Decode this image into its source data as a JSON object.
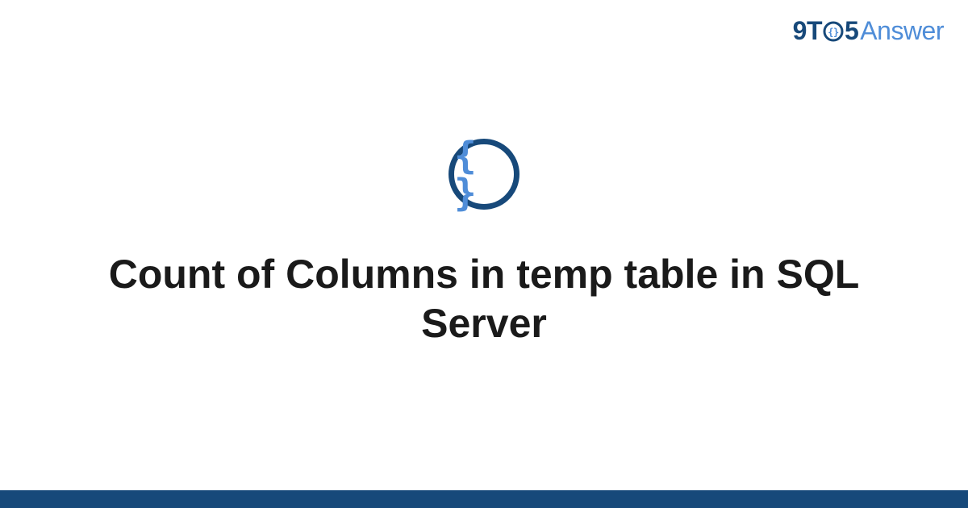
{
  "brand": {
    "part1": "9",
    "part2": "T",
    "part3_inner": "{}",
    "part4": "5",
    "part5": "Answer"
  },
  "icon": {
    "braces": "{ }"
  },
  "title": "Count of Columns in temp table in SQL Server",
  "colors": {
    "dark": "#17497a",
    "light": "#4f8dd8"
  }
}
